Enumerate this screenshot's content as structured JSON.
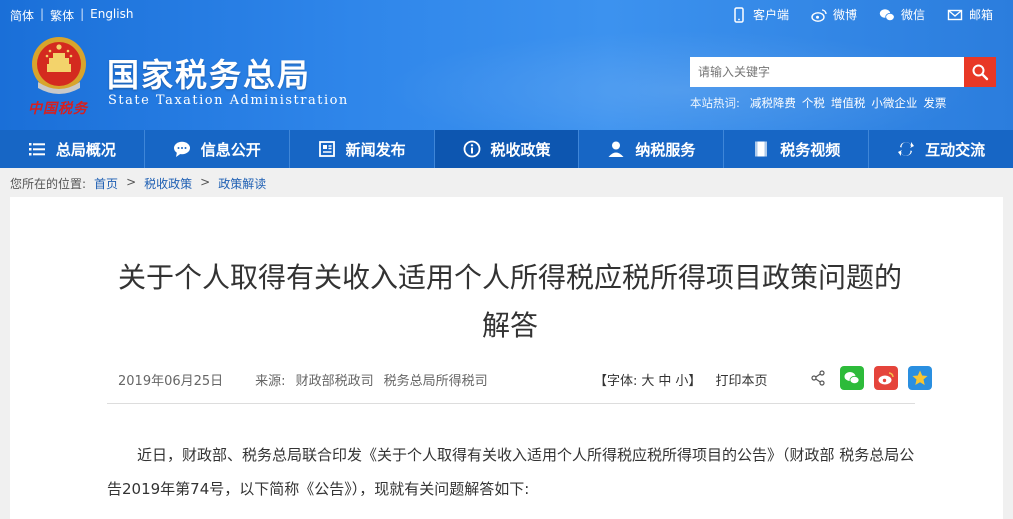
{
  "lang": {
    "simplified": "简体",
    "traditional": "繁体",
    "english": "English",
    "sep": "|"
  },
  "top_links": [
    {
      "label": "客户端",
      "icon": "mobile-icon"
    },
    {
      "label": "微博",
      "icon": "weibo-icon"
    },
    {
      "label": "微信",
      "icon": "wechat-icon"
    },
    {
      "label": "邮箱",
      "icon": "mail-icon"
    }
  ],
  "header": {
    "title": "国家税务总局",
    "subtitle": "State Taxation Administration",
    "seal_text": "中国税务"
  },
  "search": {
    "placeholder": "请输入关键字",
    "hot_label": "本站热词:",
    "hot_words": [
      "减税降费",
      "个税",
      "增值税",
      "小微企业",
      "发票"
    ]
  },
  "nav": [
    {
      "label": "总局概况",
      "icon": "menu-icon"
    },
    {
      "label": "信息公开",
      "icon": "chat-icon"
    },
    {
      "label": "新闻发布",
      "icon": "news-icon"
    },
    {
      "label": "税收政策",
      "icon": "info-icon",
      "active": true
    },
    {
      "label": "纳税服务",
      "icon": "user-icon"
    },
    {
      "label": "税务视频",
      "icon": "video-icon"
    },
    {
      "label": "互动交流",
      "icon": "exchange-icon"
    }
  ],
  "breadcrumb": {
    "label": "您所在的位置:",
    "items": [
      "首页",
      "税收政策",
      "政策解读"
    ],
    "arrow": ">"
  },
  "article": {
    "title_line1": "关于个人取得有关收入适用个人所得税应税所得项目政策问题的",
    "title_line2": "解答",
    "date": "2019年06月25日",
    "source_label": "来源:",
    "source1": "财政部税政司",
    "source2": "税务总局所得税司",
    "font_label": "【字体:",
    "font_large": "大",
    "font_medium": "中",
    "font_small": "小】",
    "print": "打印本页",
    "body": "近日，财政部、税务总局联合印发《关于个人取得有关收入适用个人所得税应税所得项目的公告》（财政部 税务总局公告2019年第74号，以下简称《公告》），现就有关问题解答如下:"
  },
  "colors": {
    "header_blue": "#2f86ea",
    "nav_blue": "#1766c5",
    "nav_active": "#0d56b0",
    "search_red": "#e83826",
    "wechat_green": "#2dbb3a",
    "weibo_red": "#e5443b",
    "qzone_blue": "#2a8fe0"
  }
}
